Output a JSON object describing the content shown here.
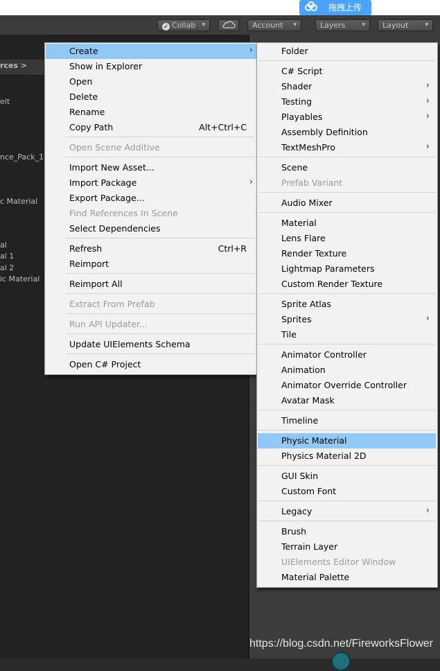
{
  "overlay": {
    "upload_label": "拖拽上传"
  },
  "toolbar": {
    "collab_label": "Collab",
    "account_label": "Account",
    "layers_label": "Layers",
    "layout_label": "Layout"
  },
  "project": {
    "header_fragment": "rces >",
    "items": [
      "elt",
      "nce_Pack_1",
      "c Material",
      "al",
      "al 1",
      "al 2",
      "ic Material"
    ]
  },
  "context_menu": {
    "items": [
      {
        "label": "Create",
        "arrow": "›"
      },
      {
        "label": "Show in Explorer"
      },
      {
        "label": "Open"
      },
      {
        "label": "Delete"
      },
      {
        "label": "Rename"
      },
      {
        "label": "Copy Path",
        "shortcut": "Alt+Ctrl+C"
      },
      {
        "label": "Open Scene Additive"
      },
      {
        "label": "Import New Asset..."
      },
      {
        "label": "Import Package",
        "arrow": "›"
      },
      {
        "label": "Export Package..."
      },
      {
        "label": "Find References In Scene"
      },
      {
        "label": "Select Dependencies"
      },
      {
        "label": "Refresh",
        "shortcut": "Ctrl+R"
      },
      {
        "label": "Reimport"
      },
      {
        "label": "Reimport All"
      },
      {
        "label": "Extract From Prefab"
      },
      {
        "label": "Run API Updater..."
      },
      {
        "label": "Update UIElements Schema"
      },
      {
        "label": "Open C# Project"
      }
    ]
  },
  "create_submenu": {
    "items": [
      {
        "label": "Folder"
      },
      {
        "label": "C# Script"
      },
      {
        "label": "Shader",
        "arrow": "›"
      },
      {
        "label": "Testing",
        "arrow": "›"
      },
      {
        "label": "Playables",
        "arrow": "›"
      },
      {
        "label": "Assembly Definition"
      },
      {
        "label": "TextMeshPro",
        "arrow": "›"
      },
      {
        "label": "Scene"
      },
      {
        "label": "Prefab Variant"
      },
      {
        "label": "Audio Mixer"
      },
      {
        "label": "Material"
      },
      {
        "label": "Lens Flare"
      },
      {
        "label": "Render Texture"
      },
      {
        "label": "Lightmap Parameters"
      },
      {
        "label": "Custom Render Texture"
      },
      {
        "label": "Sprite Atlas"
      },
      {
        "label": "Sprites",
        "arrow": "›"
      },
      {
        "label": "Tile"
      },
      {
        "label": "Animator Controller"
      },
      {
        "label": "Animation"
      },
      {
        "label": "Animator Override Controller"
      },
      {
        "label": "Avatar Mask"
      },
      {
        "label": "Timeline"
      },
      {
        "label": "Physic Material"
      },
      {
        "label": "Physics Material 2D"
      },
      {
        "label": "GUI Skin"
      },
      {
        "label": "Custom Font"
      },
      {
        "label": "Legacy",
        "arrow": "›"
      },
      {
        "label": "Brush"
      },
      {
        "label": "Terrain Layer"
      },
      {
        "label": "UIElements Editor Window"
      },
      {
        "label": "Material Palette"
      }
    ]
  },
  "watermark": "https://blog.csdn.net/FireworksFlower",
  "colors": {
    "highlight": "#90c8f6",
    "menu_bg": "#f2f2f2",
    "disabled_text": "#9a9a9a"
  }
}
